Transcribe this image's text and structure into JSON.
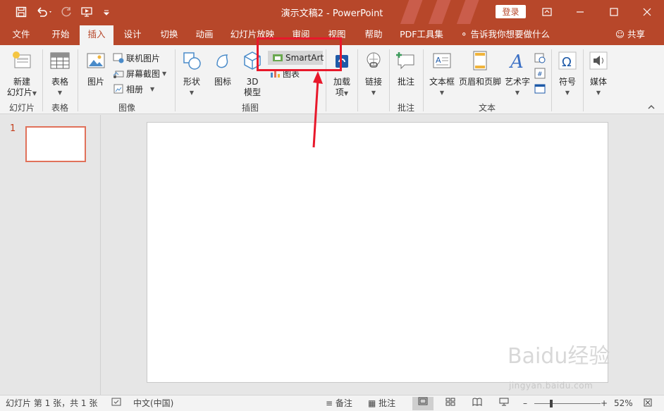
{
  "app": {
    "document_title": "演示文稿2  -  PowerPoint",
    "login_label": "登录"
  },
  "tabs": [
    "文件",
    "开始",
    "插入",
    "设计",
    "切换",
    "动画",
    "幻灯片放映",
    "审阅",
    "视图",
    "帮助",
    "PDF工具集"
  ],
  "tell_me": "告诉我你想要做什么",
  "share_label": "共享",
  "ribbon": {
    "new_slide": [
      "新建",
      "幻灯片"
    ],
    "table": "表格",
    "picture": "图片",
    "online_picture": "联机图片",
    "screenshot": "屏幕截图",
    "album": "相册",
    "shapes": "形状",
    "icons": "图标",
    "model3d": [
      "3D",
      "模型"
    ],
    "smartart": "SmartArt",
    "chart": "图表",
    "addins": [
      "加载",
      "项"
    ],
    "link": "链接",
    "comment": "批注",
    "textbox": "文本框",
    "header_footer": "页眉和页脚",
    "wordart": "艺术字",
    "symbol": "符号",
    "media": "媒体",
    "groups": {
      "slides": "幻灯片",
      "tables": "表格",
      "images": "图像",
      "illustrations": "插图",
      "comments": "批注",
      "text": "文本"
    }
  },
  "thumbnails": {
    "slide_number": "1"
  },
  "status": {
    "slide_info": "幻灯片 第 1 张，共 1 张",
    "language": "中文(中国)",
    "notes": "备注",
    "comments": "批注",
    "zoom": "52%",
    "zoom_fraction": 0.52
  },
  "watermark": {
    "brand": "Baidu经验",
    "url": "jingyan.baidu.com"
  },
  "colors": {
    "accent": "#b7472a",
    "highlight": "#e8182b"
  }
}
